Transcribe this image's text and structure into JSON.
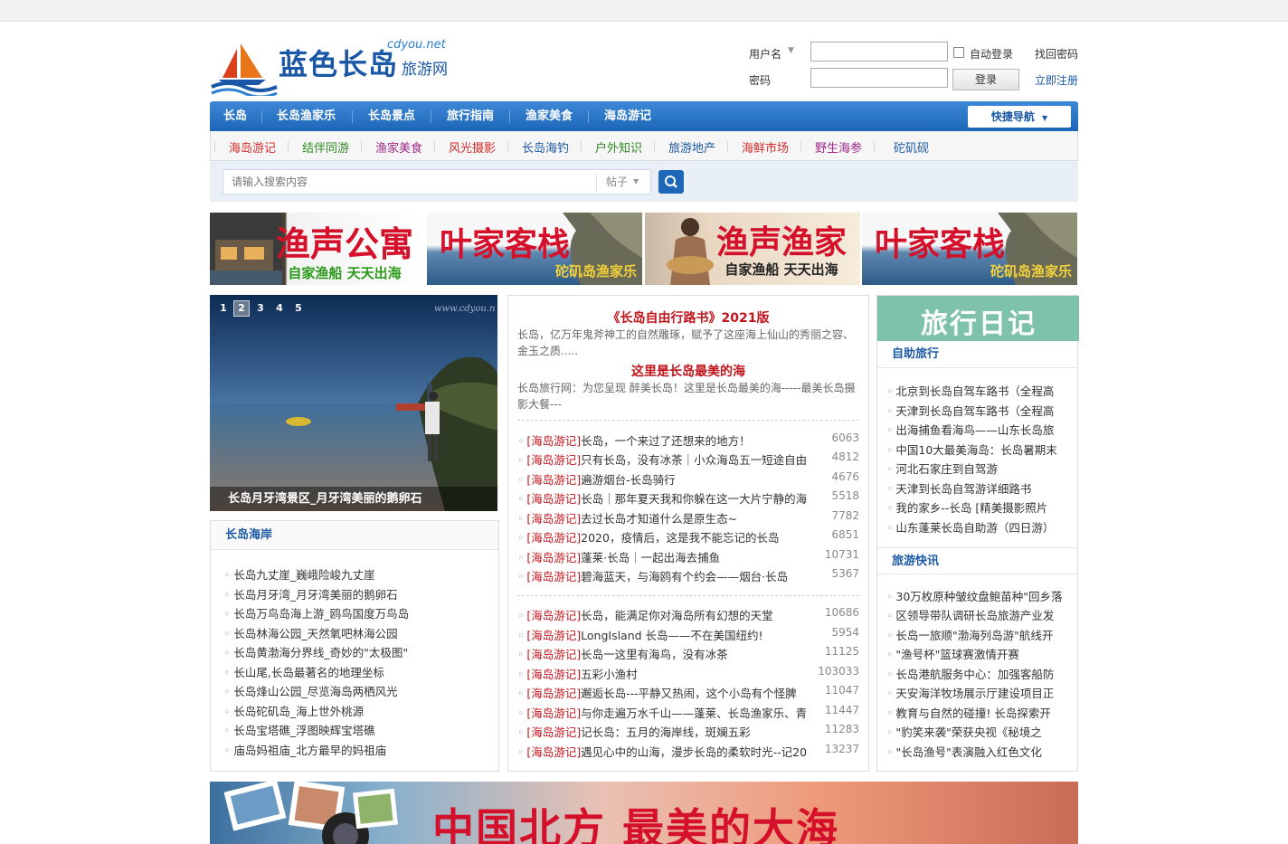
{
  "header": {
    "logo_cn": "蓝色长岛",
    "logo_en": "cdyou.net",
    "logo_sub": "旅游网"
  },
  "login": {
    "username_label": "用户名",
    "password_label": "密码",
    "auto_login": "自动登录",
    "find_password": "找回密码",
    "login_button": "登录",
    "register": "立即注册"
  },
  "nav": {
    "items": [
      "长岛",
      "长岛渔家乐",
      "长岛景点",
      "旅行指南",
      "渔家美食",
      "海岛游记"
    ],
    "quick": "快捷导航"
  },
  "subnav": {
    "items": [
      "海岛游记",
      "结伴同游",
      "渔家美食",
      "风光摄影",
      "长岛海钓",
      "户外知识",
      "旅游地产",
      "海鲜市场",
      "野生海参",
      "砣矶砚"
    ],
    "colors": [
      "#d42a2a",
      "#2f8a22",
      "#a02a8a",
      "#d42a2a",
      "#1d5aa3",
      "#2f8a22",
      "#1d5aa3",
      "#d42a2a",
      "#a02a8a",
      "#1d5aa3"
    ]
  },
  "search": {
    "placeholder": "请输入搜索内容",
    "type": "帖子"
  },
  "banners": [
    {
      "title": "渔声公寓",
      "sub": "自家渔船 天天出海"
    },
    {
      "title": "叶家客栈",
      "sub": "砣矶岛渔家乐"
    },
    {
      "title": "渔声渔家",
      "sub": "自家渔船 天天出海"
    },
    {
      "title": "叶家客栈",
      "sub": "砣矶岛渔家乐"
    }
  ],
  "slideshow": {
    "pages": [
      "1",
      "2",
      "3",
      "4",
      "5"
    ],
    "active": 2,
    "watermark": "www.cdyou.n",
    "caption": "长岛月牙湾景区_月牙湾美丽的鹅卵石"
  },
  "coast": {
    "title": "长岛海岸",
    "items": [
      "长岛九丈崖_巍峨险峻九丈崖",
      "长岛月牙湾_月牙湾美丽的鹅卵石",
      "长岛万鸟岛海上游_鸥鸟国度万鸟岛",
      "长岛林海公园_天然氧吧林海公园",
      "长岛黄渤海分界线_奇妙的\"太极图\"",
      "长山尾,长岛最著名的地理坐标",
      "长岛烽山公园_尽览海岛两栖风光",
      "长岛砣矶岛_海上世外桃源",
      "长岛宝塔礁_浮图映辉宝塔礁",
      "庙岛妈祖庙_北方最早的妈祖庙"
    ]
  },
  "middle": {
    "heading1": "《长岛自由行路书》2021版",
    "para1": "长岛，亿万年鬼斧神工的自然雕琢，赋予了这座海上仙山的秀丽之容、金玉之质.....",
    "heading2": "这里是长岛最美的海",
    "para2": "长岛旅行网：为您呈现 醉美长岛！这里是长岛最美的海-----最美长岛摄影大餐---",
    "tag": "[海岛游记]",
    "list1": [
      {
        "title": "长岛，一个来过了还想来的地方！",
        "views": "6063"
      },
      {
        "title": "只有长岛，没有冰茶｜小众海岛五一短途自由",
        "views": "4812"
      },
      {
        "title": "遍游烟台-长岛骑行",
        "views": "4676"
      },
      {
        "title": "长岛｜那年夏天我和你躲在这一大片宁静的海",
        "views": "5518"
      },
      {
        "title": "去过长岛才知道什么是原生态~",
        "views": "7782"
      },
      {
        "title": "2020，疫情后，这是我不能忘记的长岛",
        "views": "6851"
      },
      {
        "title": "蓬莱·长岛｜一起出海去捕鱼",
        "views": "10731"
      },
      {
        "title": "碧海蓝天，与海鸥有个约会——烟台·长岛",
        "views": "5367"
      }
    ],
    "list2": [
      {
        "title": "长岛，能满足你对海岛所有幻想的天堂",
        "views": "10686"
      },
      {
        "title": "LongIsland 长岛——不在美国纽约!",
        "views": "5954"
      },
      {
        "title": "长岛一这里有海鸟，没有冰茶",
        "views": "11125"
      },
      {
        "title": "五彩小渔村",
        "views": "103033"
      },
      {
        "title": "邂逅长岛---平静又热闹，这个小岛有个怪脾",
        "views": "11047"
      },
      {
        "title": "与你走遍万水千山——蓬莱、长岛渔家乐、青",
        "views": "11447"
      },
      {
        "title": "记长岛：五月的海岸线，斑斓五彩",
        "views": "11283"
      },
      {
        "title": "遇见心中的山海，漫步长岛的柔软时光--记20",
        "views": "13237"
      }
    ]
  },
  "right": {
    "banner_text": "旅行日记",
    "self_title": "自助旅行",
    "self_items": [
      "北京到长岛自驾车路书（全程高",
      "天津到长岛自驾车路书（全程高",
      "出海捕鱼看海鸟——山东长岛旅",
      "中国10大最美海岛：长岛暑期末",
      "河北石家庄到自驾游",
      "天津到长岛自驾游详细路书",
      "我的家乡--长岛 [精美摄影照片",
      "山东蓬莱长岛自助游（四日游）"
    ],
    "news_title": "旅游快讯",
    "news_items": [
      "30万枚原种皱纹盘鲍苗种\"回乡落",
      "区领导带队调研长岛旅游产业发",
      "长岛一旅顺\"渤海列岛游\"航线开",
      "\"渔号杯\"篮球赛激情开赛",
      "长岛港航服务中心：加强客船防",
      "天安海洋牧场展示厅建设项目正",
      "教育与自然的碰撞! 长岛探索开",
      "\"豹笑来袭\"荣获央视《秘境之",
      "\"长岛渔号\"表演融入红色文化"
    ]
  },
  "bottom_banner": {
    "text": "中国北方  最美的大海"
  },
  "colors": {
    "brand_blue": "#1d66b8",
    "tag_red": "#c0151c"
  }
}
